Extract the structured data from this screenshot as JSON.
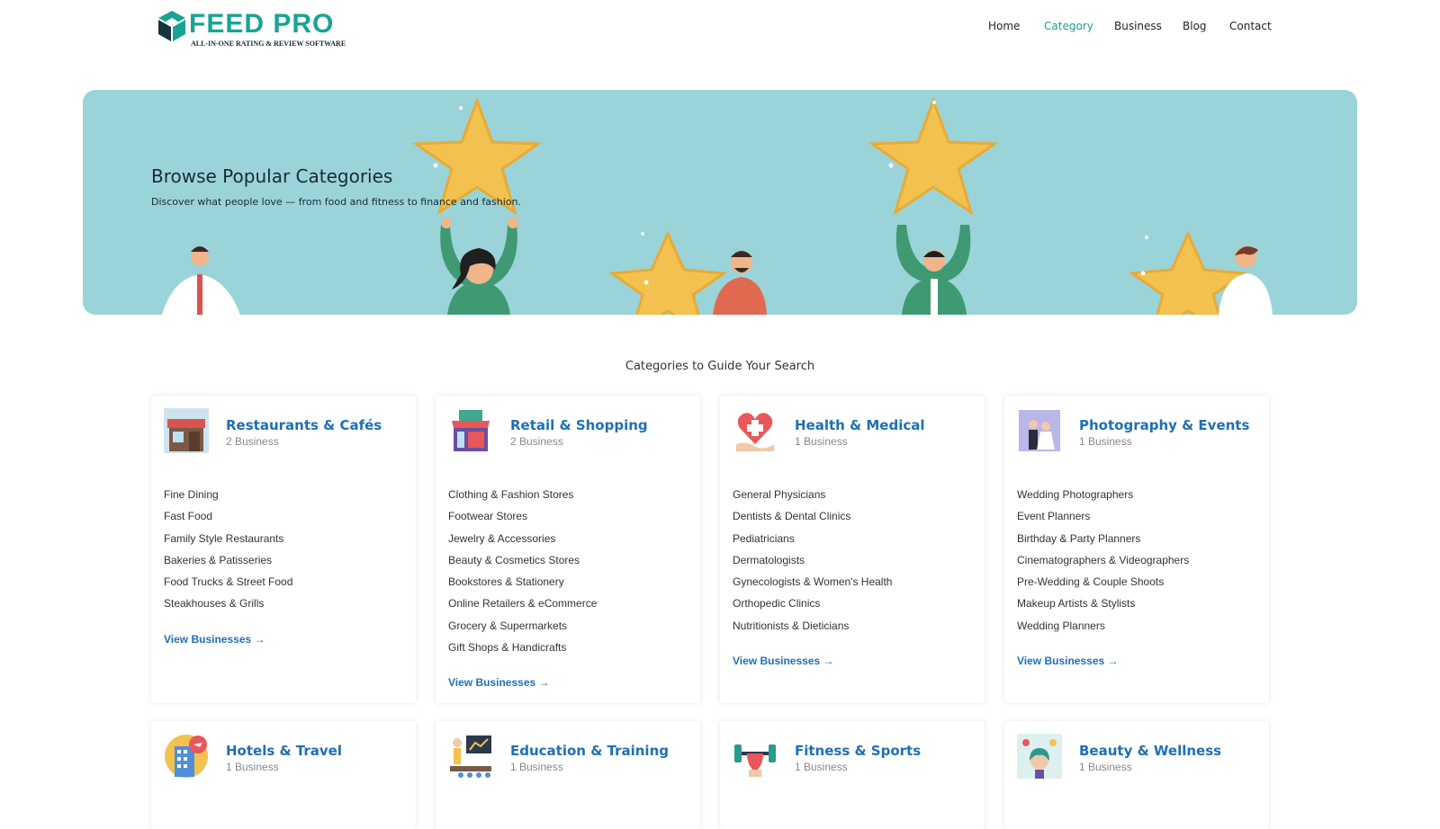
{
  "brand": {
    "name": "FEED PRO",
    "tagline": "ALL-IN-ONE RATING & REVIEW SOFTWARE"
  },
  "nav": {
    "items": [
      "Home",
      "Category",
      "Business",
      "Blog",
      "Contact"
    ],
    "active": "Category"
  },
  "hero": {
    "title": "Browse Popular Categories",
    "subtitle": "Discover what people love — from food and fitness to finance and fashion."
  },
  "section": {
    "title": "Categories to Guide Your Search"
  },
  "colors": {
    "accent": "#1f9e8e",
    "link": "#1f6fb5",
    "hero_bg": "#9ad4d9",
    "star": "#f3c14f"
  },
  "categories": [
    {
      "title": "Restaurants & Cafés",
      "count": "2 Business",
      "icon": "restaurant-icon",
      "items": [
        "Fine Dining",
        "Fast Food",
        "Family Style Restaurants",
        "Bakeries & Patisseries",
        "Food Trucks & Street Food",
        "Steakhouses & Grills"
      ],
      "link": "View Businesses →"
    },
    {
      "title": "Retail & Shopping",
      "count": "2 Business",
      "icon": "shop-icon",
      "items": [
        "Clothing & Fashion Stores",
        "Footwear Stores",
        "Jewelry & Accessories",
        "Beauty & Cosmetics Stores",
        "Bookstores & Stationery",
        "Online Retailers & eCommerce",
        "Grocery & Supermarkets",
        "Gift Shops & Handicrafts"
      ],
      "link": "View Businesses →"
    },
    {
      "title": "Health & Medical",
      "count": "1 Business",
      "icon": "health-icon",
      "items": [
        "General Physicians",
        "Dentists & Dental Clinics",
        "Pediatricians",
        "Dermatologists",
        "Gynecologists & Women's Health",
        "Orthopedic Clinics",
        "Nutritionists & Dieticians"
      ],
      "link": "View Businesses →"
    },
    {
      "title": "Photography & Events",
      "count": "1 Business",
      "icon": "wedding-photo-icon",
      "items": [
        "Wedding Photographers",
        "Event Planners",
        "Birthday & Party Planners",
        "Cinematographers & Videographers",
        "Pre-Wedding & Couple Shoots",
        "Makeup Artists & Stylists",
        "Wedding Planners"
      ],
      "link": "View Businesses →"
    },
    {
      "title": "Hotels & Travel",
      "count": "1 Business",
      "icon": "hotel-travel-icon",
      "items": [],
      "link": ""
    },
    {
      "title": "Education & Training",
      "count": "1 Business",
      "icon": "education-icon",
      "items": [],
      "link": ""
    },
    {
      "title": "Fitness & Sports",
      "count": "1 Business",
      "icon": "fitness-icon",
      "items": [],
      "link": ""
    },
    {
      "title": "Beauty & Wellness",
      "count": "1 Business",
      "icon": "beauty-icon",
      "items": [],
      "link": ""
    }
  ]
}
